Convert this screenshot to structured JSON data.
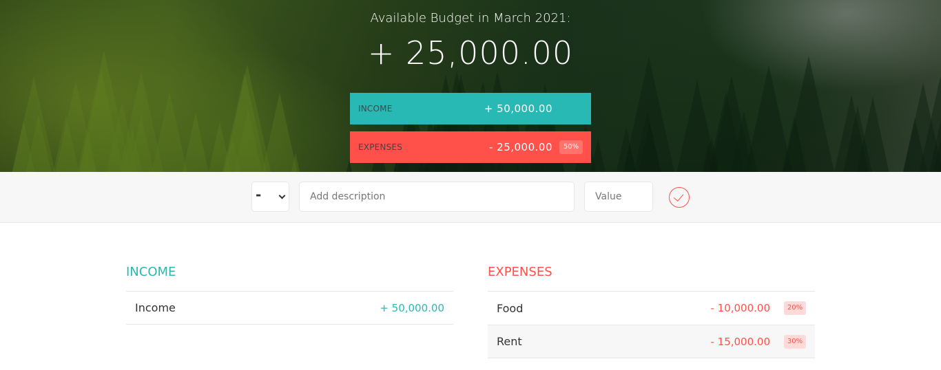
{
  "budget": {
    "title": "Available Budget in March 2021:",
    "value": "+ 25,000.00"
  },
  "summary": {
    "income": {
      "label": "Income",
      "value": "+ 50,000.00"
    },
    "expenses": {
      "label": "Expenses",
      "value": "- 25,000.00",
      "percentage": "50%"
    }
  },
  "add": {
    "type_value": "-",
    "description_placeholder": "Add description",
    "value_placeholder": "Value",
    "submit_icon": "check-circle-icon"
  },
  "income_list": {
    "title": "Income",
    "items": [
      {
        "description": "Income",
        "value": "+ 50,000.00"
      }
    ]
  },
  "expenses_list": {
    "title": "Expenses",
    "items": [
      {
        "description": "Food",
        "value": "- 10,000.00",
        "percentage": "20%"
      },
      {
        "description": "Rent",
        "value": "- 15,000.00",
        "percentage": "30%"
      }
    ]
  },
  "colors": {
    "income": "#28b9b5",
    "expenses": "#ff5049"
  }
}
